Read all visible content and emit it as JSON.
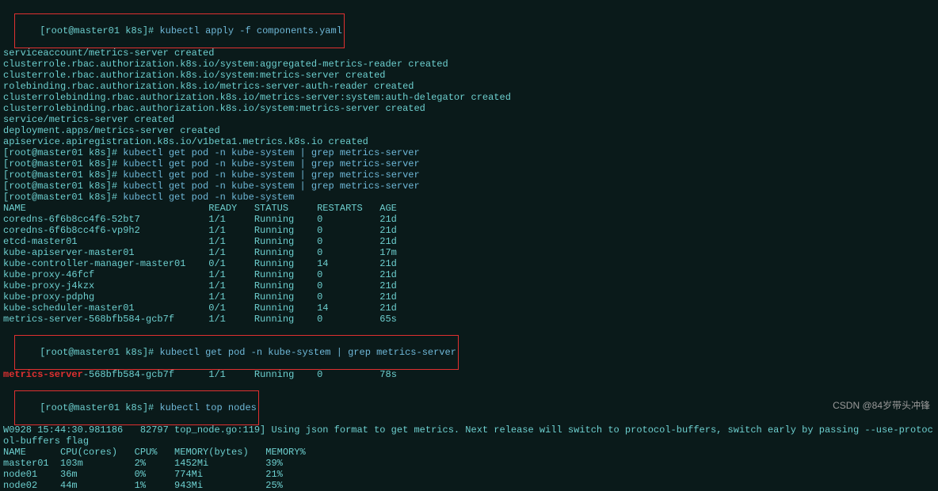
{
  "prompt": "[root@master01 k8s]# ",
  "cmd1": "kubectl apply -f components.yaml",
  "apply_output": [
    "serviceaccount/metrics-server created",
    "clusterrole.rbac.authorization.k8s.io/system:aggregated-metrics-reader created",
    "clusterrole.rbac.authorization.k8s.io/system:metrics-server created",
    "rolebinding.rbac.authorization.k8s.io/metrics-server-auth-reader created",
    "clusterrolebinding.rbac.authorization.k8s.io/metrics-server:system:auth-delegator created",
    "clusterrolebinding.rbac.authorization.k8s.io/system:metrics-server created",
    "service/metrics-server created",
    "deployment.apps/metrics-server created",
    "apiservice.apiregistration.k8s.io/v1beta1.metrics.k8s.io created"
  ],
  "cmd_grep": "kubectl get pod -n kube-system | grep metrics-server",
  "cmd_getpod": "kubectl get pod -n kube-system",
  "pod_header": {
    "name": "NAME",
    "ready": "READY",
    "status": "STATUS",
    "restarts": "RESTARTS",
    "age": "AGE"
  },
  "pods": [
    {
      "name": "coredns-6f6b8cc4f6-52bt7",
      "ready": "1/1",
      "status": "Running",
      "restarts": "0",
      "age": "21d"
    },
    {
      "name": "coredns-6f6b8cc4f6-vp9h2",
      "ready": "1/1",
      "status": "Running",
      "restarts": "0",
      "age": "21d"
    },
    {
      "name": "etcd-master01",
      "ready": "1/1",
      "status": "Running",
      "restarts": "0",
      "age": "21d"
    },
    {
      "name": "kube-apiserver-master01",
      "ready": "1/1",
      "status": "Running",
      "restarts": "0",
      "age": "17m"
    },
    {
      "name": "kube-controller-manager-master01",
      "ready": "0/1",
      "status": "Running",
      "restarts": "14",
      "age": "21d"
    },
    {
      "name": "kube-proxy-46fcf",
      "ready": "1/1",
      "status": "Running",
      "restarts": "0",
      "age": "21d"
    },
    {
      "name": "kube-proxy-j4kzx",
      "ready": "1/1",
      "status": "Running",
      "restarts": "0",
      "age": "21d"
    },
    {
      "name": "kube-proxy-pdphg",
      "ready": "1/1",
      "status": "Running",
      "restarts": "0",
      "age": "21d"
    },
    {
      "name": "kube-scheduler-master01",
      "ready": "0/1",
      "status": "Running",
      "restarts": "14",
      "age": "21d"
    },
    {
      "name": "metrics-server-568bfb584-gcb7f",
      "ready": "1/1",
      "status": "Running",
      "restarts": "0",
      "age": "65s"
    }
  ],
  "grep_row": {
    "name_red": "metrics-server",
    "name_rest": "-568bfb584-gcb7f",
    "ready": "1/1",
    "status": "Running",
    "restarts": "0",
    "age": "78s"
  },
  "cmd_top": "kubectl top nodes",
  "top_warn": "W0928 15:44:30.981186   82797 top_node.go:119] Using json format to get metrics. Next release will switch to protocol-buffers, switch early by passing --use-protocol-buffers flag",
  "node_header": {
    "name": "NAME",
    "cpu_c": "CPU(cores)",
    "cpu_p": "CPU%",
    "mem_b": "MEMORY(bytes)",
    "mem_p": "MEMORY%"
  },
  "nodes": [
    {
      "name": "master01",
      "cpu_c": "103m",
      "cpu_p": "2%",
      "mem_b": "1452Mi",
      "mem_p": "39%"
    },
    {
      "name": "node01",
      "cpu_c": "36m",
      "cpu_p": "0%",
      "mem_b": "774Mi",
      "mem_p": "21%"
    },
    {
      "name": "node02",
      "cpu_c": "44m",
      "cpu_p": "1%",
      "mem_b": "943Mi",
      "mem_p": "25%"
    }
  ],
  "watermark": "CSDN @84岁带头冲锋"
}
